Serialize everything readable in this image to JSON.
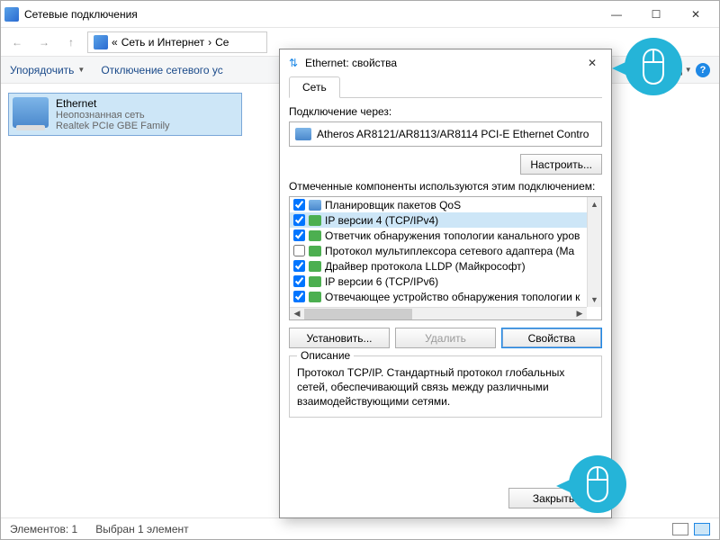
{
  "explorer": {
    "title": "Сетевые подключения",
    "breadcrumb_sep": "«",
    "breadcrumb_1": "Сеть и Интернет",
    "breadcrumb_chev": "›",
    "breadcrumb_2": "Се",
    "toolbar": {
      "organize": "Упорядочить",
      "disable": "Отключение сетевого ус"
    },
    "adapter": {
      "name": "Ethernet",
      "status": "Неопознанная сеть",
      "device": "Realtek PCIe GBE Family"
    },
    "statusbar": {
      "count": "Элементов: 1",
      "selected": "Выбран 1 элемент"
    }
  },
  "dialog": {
    "title": "Ethernet: свойства",
    "tab": "Сеть",
    "connect_via": "Подключение через:",
    "adapter_name": "Atheros AR8121/AR8113/AR8114 PCI-E Ethernet Contro",
    "configure": "Настроить...",
    "components_label": "Отмеченные компоненты используются этим подключением:",
    "install": "Установить...",
    "remove": "Удалить",
    "properties": "Свойства",
    "desc_title": "Описание",
    "desc_text": "Протокол TCP/IP. Стандартный протокол глобальных сетей, обеспечивающий связь между различными взаимодействующими сетями.",
    "close": "Закрыть",
    "components": [
      {
        "checked": true,
        "icon": "qos",
        "label": "Планировщик пакетов QoS"
      },
      {
        "checked": true,
        "icon": "proto",
        "label": "IP версии 4 (TCP/IPv4)",
        "selected": true
      },
      {
        "checked": true,
        "icon": "proto",
        "label": "Ответчик обнаружения топологии канального уров"
      },
      {
        "checked": false,
        "icon": "proto",
        "label": "Протокол мультиплексора сетевого адаптера (Ma"
      },
      {
        "checked": true,
        "icon": "proto",
        "label": "Драйвер протокола LLDP (Майкрософт)"
      },
      {
        "checked": true,
        "icon": "proto",
        "label": "IP версии 6 (TCP/IPv6)"
      },
      {
        "checked": true,
        "icon": "proto",
        "label": "Отвечающее устройство обнаружения топологии к"
      }
    ]
  }
}
